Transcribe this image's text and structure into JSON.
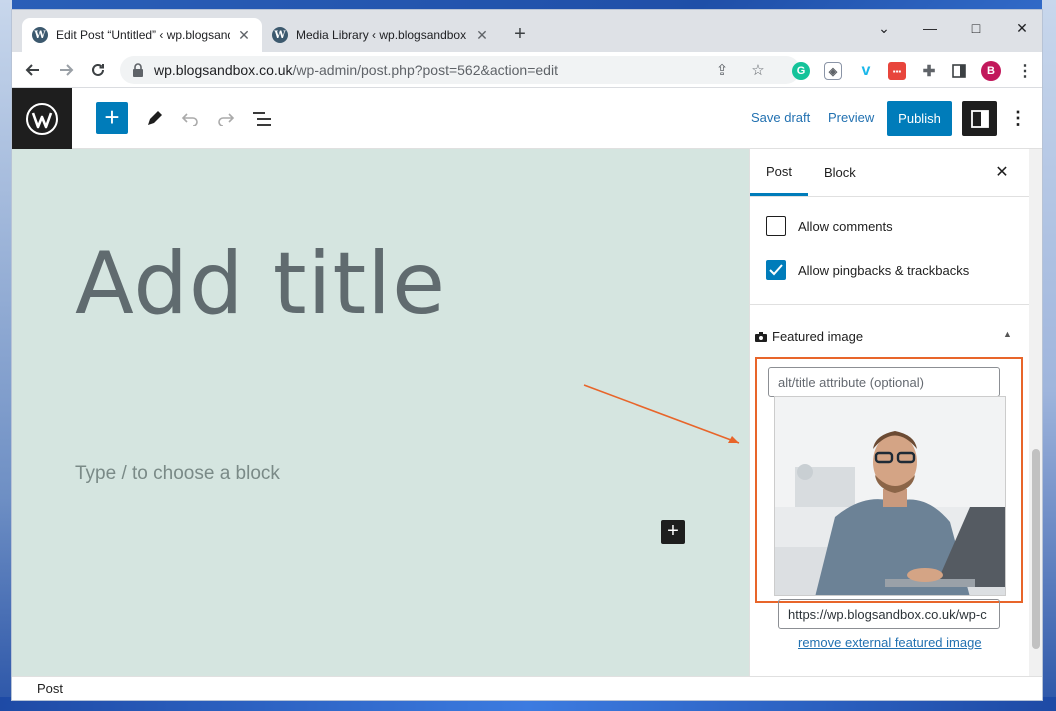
{
  "browser": {
    "tabs": [
      {
        "title": "Edit Post “Untitled” ‹ wp.blogsandbox",
        "active": true
      },
      {
        "title": "Media Library ‹ wp.blogsandbox",
        "active": false
      }
    ],
    "new_tab": "+",
    "window_controls": {
      "dropdown": "⌄",
      "minimize": "—",
      "maximize": "□",
      "close": "✕"
    },
    "url_host": "wp.blogsandbox.co.uk",
    "url_path": "/wp-admin/post.php?post=562&action=edit",
    "profile_initial": "B"
  },
  "editor": {
    "toolbar": {
      "save_draft": "Save draft",
      "preview": "Preview",
      "publish": "Publish"
    },
    "title_placeholder": "Add title",
    "block_placeholder": "Type / to choose a block",
    "footer_breadcrumb": "Post"
  },
  "sidebar": {
    "tabs": [
      "Post",
      "Block"
    ],
    "active_tab": "Post",
    "discussion": [
      {
        "label": "Allow comments",
        "checked": false
      },
      {
        "label": "Allow pingbacks & trackbacks",
        "checked": true
      }
    ],
    "featured_image": {
      "heading": "Featured image",
      "alt_placeholder": "alt/title attribute (optional)",
      "url_value": "https://wp.blogsandbox.co.uk/wp-c",
      "remove_link": "remove external featured image"
    }
  },
  "colors": {
    "wp_blue": "#007cba",
    "highlight": "#e8652a",
    "canvas": "#d5e5e0"
  }
}
